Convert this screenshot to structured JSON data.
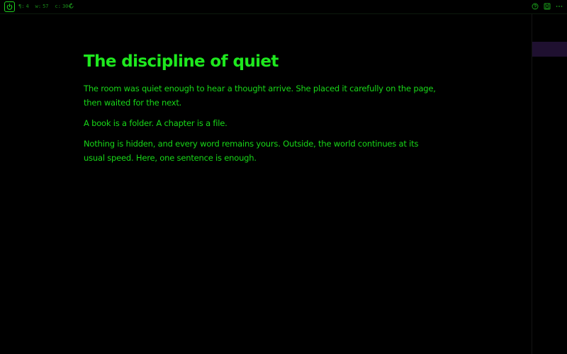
{
  "toolbar": {
    "power_icon": "power-icon",
    "stats": [
      {
        "prefix": "¶:",
        "value": "4"
      },
      {
        "prefix": "w:",
        "value": "57"
      },
      {
        "prefix": "c:",
        "value": "304"
      }
    ],
    "refresh_icon": "refresh-icon",
    "right_icons": [
      "help-circle-icon",
      "save-icon",
      "more-horizontal-icon"
    ]
  },
  "document": {
    "title": "The discipline of quiet",
    "paragraphs": [
      "The room was quiet enough to hear a thought arrive. She placed it carefully on the page, then waited for the next.",
      "A book is a folder. A chapter is a file.",
      "Nothing is hidden, and every word remains yours. Outside, the world continues at its usual speed. Here, one sentence is enough."
    ]
  },
  "theme": {
    "background": "#000000",
    "text": "#18d818",
    "accent": "#1ee81e",
    "dim": "#1a8a1a",
    "selection": "#1f1030"
  }
}
